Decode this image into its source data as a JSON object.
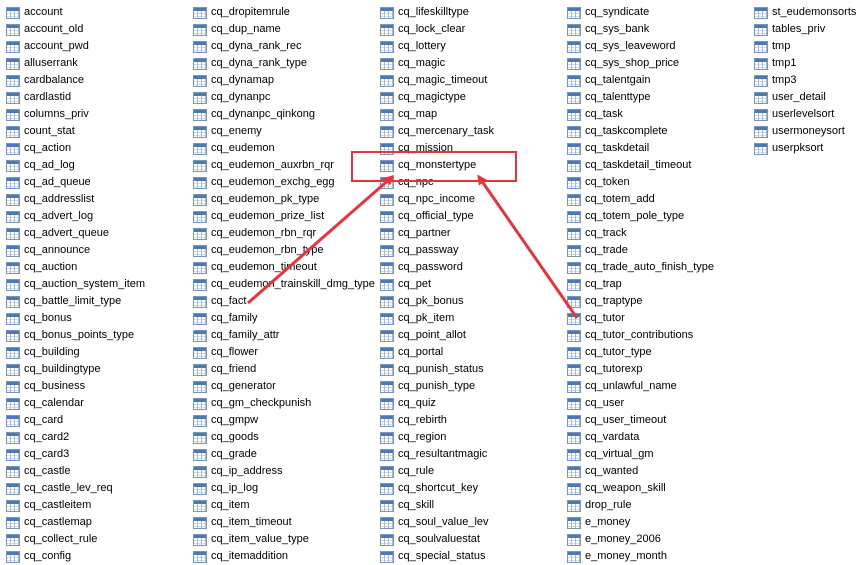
{
  "columns": [
    [
      "account",
      "account_old",
      "account_pwd",
      "alluserrank",
      "cardbalance",
      "cardlastid",
      "columns_priv",
      "count_stat",
      "cq_action",
      "cq_ad_log",
      "cq_ad_queue",
      "cq_addresslist",
      "cq_advert_log",
      "cq_advert_queue",
      "cq_announce",
      "cq_auction",
      "cq_auction_system_item",
      "cq_battle_limit_type",
      "cq_bonus",
      "cq_bonus_points_type",
      "cq_building",
      "cq_buildingtype",
      "cq_business",
      "cq_calendar",
      "cq_card",
      "cq_card2",
      "cq_card3",
      "cq_castle",
      "cq_castle_lev_req",
      "cq_castleitem",
      "cq_castlemap",
      "cq_collect_rule",
      "cq_config"
    ],
    [
      "cq_dropitemrule",
      "cq_dup_name",
      "cq_dyna_rank_rec",
      "cq_dyna_rank_type",
      "cq_dynamap",
      "cq_dynanpc",
      "cq_dynanpc_qinkong",
      "cq_enemy",
      "cq_eudemon",
      "cq_eudemon_auxrbn_rqr",
      "cq_eudemon_exchg_egg",
      "cq_eudemon_pk_type",
      "cq_eudemon_prize_list",
      "cq_eudemon_rbn_rqr",
      "cq_eudemon_rbn_type",
      "cq_eudemon_timeout",
      "cq_eudemon_trainskill_dmg_type",
      "cq_fact",
      "cq_family",
      "cq_family_attr",
      "cq_flower",
      "cq_friend",
      "cq_generator",
      "cq_gm_checkpunish",
      "cq_gmpw",
      "cq_goods",
      "cq_grade",
      "cq_ip_address",
      "cq_ip_log",
      "cq_item",
      "cq_item_timeout",
      "cq_item_value_type",
      "cq_itemaddition"
    ],
    [
      "cq_lifeskilltype",
      "cq_lock_clear",
      "cq_lottery",
      "cq_magic",
      "cq_magic_timeout",
      "cq_magictype",
      "cq_map",
      "cq_mercenary_task",
      "cq_mission",
      "cq_monstertype",
      "cq_npc",
      "cq_npc_income",
      "cq_official_type",
      "cq_partner",
      "cq_passway",
      "cq_password",
      "cq_pet",
      "cq_pk_bonus",
      "cq_pk_item",
      "cq_point_allot",
      "cq_portal",
      "cq_punish_status",
      "cq_punish_type",
      "cq_quiz",
      "cq_rebirth",
      "cq_region",
      "cq_resultantmagic",
      "cq_rule",
      "cq_shortcut_key",
      "cq_skill",
      "cq_soul_value_lev",
      "cq_soulvaluestat",
      "cq_special_status"
    ],
    [
      "cq_syndicate",
      "cq_sys_bank",
      "cq_sys_leaveword",
      "cq_sys_shop_price",
      "cq_talentgain",
      "cq_talenttype",
      "cq_task",
      "cq_taskcomplete",
      "cq_taskdetail",
      "cq_taskdetail_timeout",
      "cq_token",
      "cq_totem_add",
      "cq_totem_pole_type",
      "cq_track",
      "cq_trade",
      "cq_trade_auto_finish_type",
      "cq_trap",
      "cq_traptype",
      "cq_tutor",
      "cq_tutor_contributions",
      "cq_tutor_type",
      "cq_tutorexp",
      "cq_unlawful_name",
      "cq_user",
      "cq_user_timeout",
      "cq_vardata",
      "cq_virtual_gm",
      "cq_wanted",
      "cq_weapon_skill",
      "drop_rule",
      "e_money",
      "e_money_2006",
      "e_money_month"
    ],
    [
      "st_eudemonsorts",
      "tables_priv",
      "tmp",
      "tmp1",
      "tmp3",
      "user_detail",
      "userlevelsort",
      "usermoneysort",
      "userpksort"
    ]
  ],
  "highlighted_item": "cq_monstertype",
  "annotation": {
    "color": "#e8333a",
    "icon": "table-icon"
  }
}
